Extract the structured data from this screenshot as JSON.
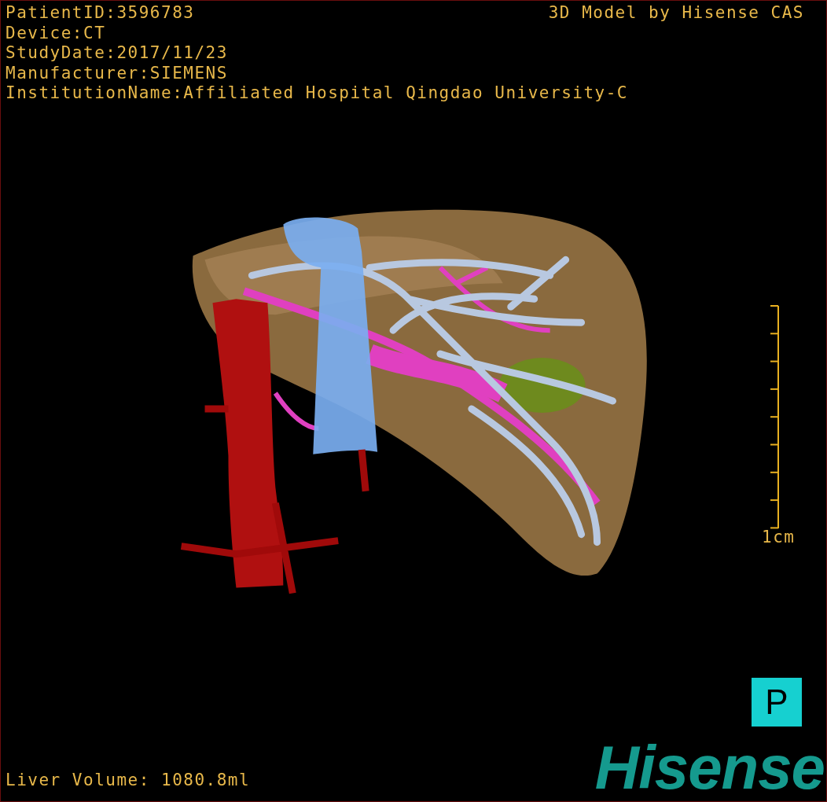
{
  "patient_info": [
    "PatientID:3596783",
    "Device:CT",
    "StudyDate:2017/11/23",
    "Manufacturer:SIEMENS",
    "InstitutionName:Affiliated Hospital Qingdao University-C"
  ],
  "model_credit": "3D Model by Hisense CAS",
  "scale_bar": {
    "label": "1cm"
  },
  "orientation_marker": "P",
  "liver_volume": "Liver Volume: 1080.8ml",
  "logo": "Hisense"
}
